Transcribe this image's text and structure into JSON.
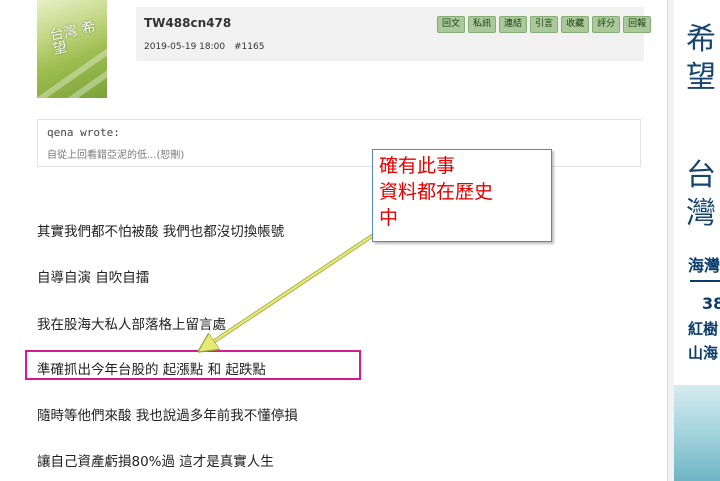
{
  "post": {
    "username": "TW488cn478",
    "date": "2019-05-19 18:00",
    "post_number": "#1165",
    "avatar_text": "台灣 希望"
  },
  "actions": [
    "回文",
    "私訊",
    "連結",
    "引言",
    "收藏",
    "評分",
    "回報"
  ],
  "quote": {
    "author": "qena wrote:",
    "text": "自從上回看錯亞泥的低...(恕刪)"
  },
  "body_lines": [
    "其實我們都不怕被酸 我們也都沒切換帳號",
    "自導自演 自吹自擂",
    "我在股海大私人部落格上留言處",
    "準確抓出今年台股的 起漲點 和 起跌點",
    "隨時等他們來酸 我也說過多年前我不懂停損",
    "讓自己資產虧損80%過 這才是真實人生"
  ],
  "callout": {
    "lines": [
      "確有此事",
      "資料都在歷史",
      "中"
    ]
  },
  "ad": {
    "top_chars": [
      "希",
      "望",
      "台",
      "灣"
    ],
    "title": "海灣",
    "lines": [
      "38",
      "紅樹",
      "山海"
    ]
  },
  "colors": {
    "highlight_border": "#d61b8f",
    "callout_text": "#e10000",
    "callout_border": "#5b86c5",
    "arrow": "#e4ea72",
    "action_button": "#a9c99a"
  }
}
